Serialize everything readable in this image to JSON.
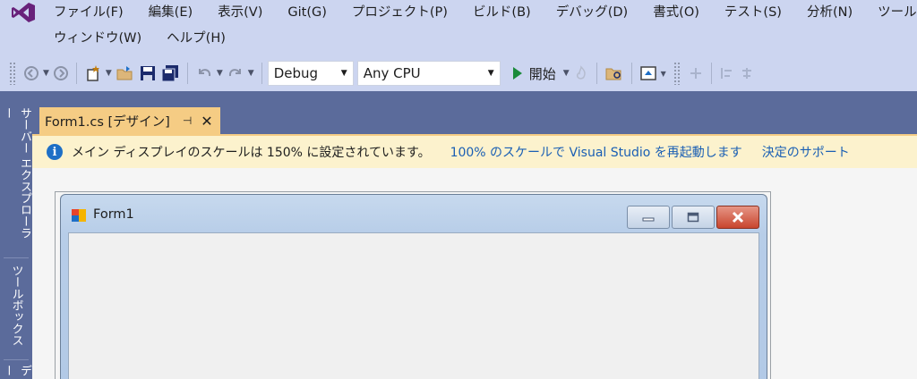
{
  "menu": {
    "row1": [
      "ファイル(F)",
      "編集(E)",
      "表示(V)",
      "Git(G)",
      "プロジェクト(P)",
      "ビルド(B)",
      "デバッグ(D)",
      "書式(O)",
      "テスト(S)",
      "分析(N)",
      "ツール("
    ],
    "row2": [
      "ウィンドウ(W)",
      "ヘルプ(H)"
    ]
  },
  "toolbar": {
    "configuration": "Debug",
    "platform": "Any CPU",
    "start_label": "開始"
  },
  "left_tabs": [
    "サーバー エクスプローラー",
    "ツールボックス",
    "デー"
  ],
  "document_tab": {
    "title": "Form1.cs [デザイン]",
    "pin_glyph": "⊣",
    "close_glyph": "✕"
  },
  "infobar": {
    "icon_glyph": "i",
    "message": "メイン ディスプレイのスケールは 150% に設定されています。",
    "link_restart": "100% のスケールで Visual Studio を再起動します",
    "link_help": "決定のサポート"
  },
  "form_window": {
    "title": "Form1"
  },
  "colors": {
    "menubar_bg": "#ccd5f0",
    "tab_strip_bg": "#5b6b9b",
    "active_tab_bg": "#f5cc84",
    "infobar_bg": "#fcf2cd",
    "link": "#1a5fb4",
    "start_green": "#1a8a3a",
    "vs_purple": "#68217a"
  },
  "icons": [
    "visual-studio-logo-icon",
    "back-icon",
    "forward-icon",
    "new-project-icon",
    "open-folder-icon",
    "save-icon",
    "save-all-icon",
    "undo-icon",
    "redo-icon",
    "play-icon",
    "hot-reload-icon",
    "find-in-files-icon",
    "browser-icon",
    "info-icon",
    "pin-icon",
    "close-icon",
    "form-icon",
    "minimize-icon",
    "maximize-icon",
    "window-close-icon"
  ]
}
